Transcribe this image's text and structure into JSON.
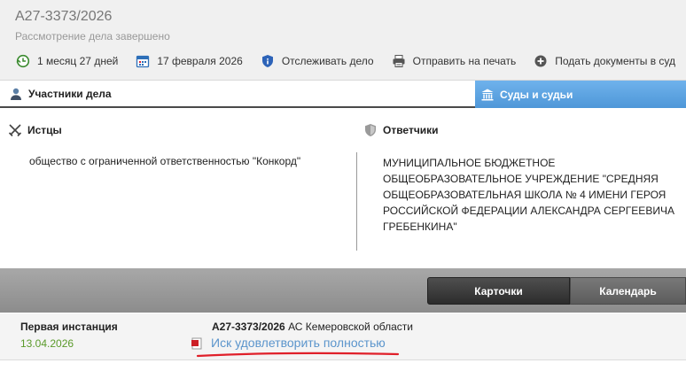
{
  "header": {
    "case_number": "А27-3373/2026",
    "status": "Рассмотрение дела завершено",
    "duration": "1 месяц 27 дней",
    "date": "17 февраля 2026",
    "track": "Отслеживать дело",
    "print": "Отправить на печать",
    "submit": "Подать документы в суд"
  },
  "tabs": {
    "participants": "Участники дела",
    "courts": "Суды и судьи"
  },
  "participants": {
    "plaintiffs_title": "Истцы",
    "plaintiff": "общество с ограниченной ответственностью \"Конкорд\"",
    "defendants_title": "Ответчики",
    "defendant": "МУНИЦИПАЛЬНОЕ БЮДЖЕТНОЕ ОБЩЕОБРАЗОВАТЕЛЬНОЕ УЧРЕЖДЕНИЕ \"СРЕДНЯЯ ОБЩЕОБРАЗОВАТЕЛЬНАЯ ШКОЛА № 4 ИМЕНИ ГЕРОЯ РОССИЙСКОЙ ФЕДЕРАЦИИ АЛЕКСАНДРА СЕРГЕЕВИЧА ГРЕБЕНКИНА\""
  },
  "view_buttons": {
    "cards": "Карточки",
    "calendar": "Календарь"
  },
  "instance": {
    "label": "Первая инстанция",
    "date": "13.04.2026",
    "case_number": "А27-3373/2026",
    "court": " АС Кемеровской области",
    "decision": "Иск удовлетворить полностью"
  },
  "colors": {
    "courts_tab": "#4e97d8",
    "instance_date": "#5a9a2a",
    "decision_link": "#5b95cc",
    "annotation_underline": "#e0202a"
  }
}
